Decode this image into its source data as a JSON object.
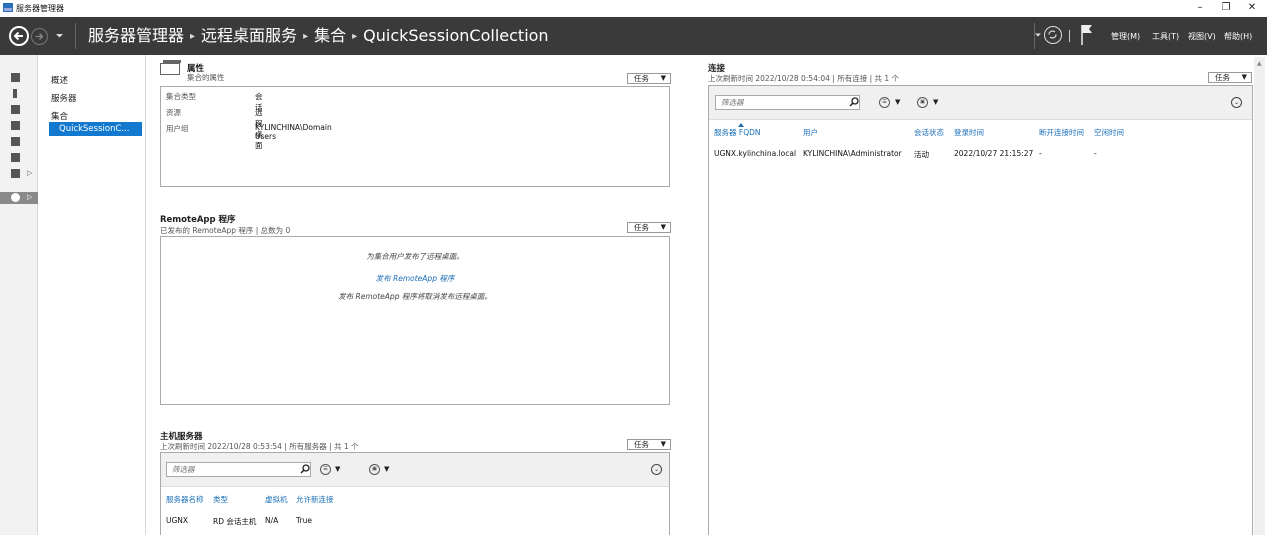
{
  "window": {
    "title": "服务器管理器",
    "minimize": "–",
    "restore": "❐",
    "close": "✕"
  },
  "header": {
    "breadcrumb": [
      "服务器管理器",
      "远程桌面服务",
      "集合",
      "QuickSessionCollection"
    ],
    "separator": "▸",
    "menus": [
      "管理(M)",
      "工具(T)",
      "视图(V)",
      "帮助(H)"
    ]
  },
  "nav": {
    "items": [
      "概述",
      "服务器",
      "集合"
    ],
    "sub_item": "QuickSessionC..."
  },
  "properties": {
    "title": "属性",
    "subtitle": "集合的属性",
    "tasks_label": "任务",
    "rows": [
      {
        "key": "集合类型",
        "value": "会话"
      },
      {
        "key": "资源",
        "value": "远程桌面"
      },
      {
        "key": "用户组",
        "value": "KYLINCHINA\\Domain Users"
      }
    ]
  },
  "remoteapp": {
    "title": "RemoteApp 程序",
    "subtitle": "已发布的 RemoteApp 程序 | 总数为 0",
    "tasks_label": "任务",
    "line1": "为集合用户发布了远程桌面。",
    "link": "发布 RemoteApp 程序",
    "line3": "发布 RemoteApp 程序将取消发布远程桌面。"
  },
  "hosts": {
    "title": "主机服务器",
    "subtitle": "上次刷新时间 2022/10/28 0:53:54 | 所有服务器 | 共 1 个",
    "tasks_label": "任务",
    "filter_placeholder": "筛选器",
    "columns": [
      "服务器名称",
      "类型",
      "虚拟机",
      "允许新连接"
    ],
    "rows": [
      [
        "UGNX",
        "RD 会话主机",
        "N/A",
        "True"
      ]
    ]
  },
  "connections": {
    "title": "连接",
    "subtitle": "上次刷新时间 2022/10/28 0:54:04 | 所有连接 | 共 1 个",
    "tasks_label": "任务",
    "filter_placeholder": "筛选器",
    "columns": [
      "服务器 FQDN",
      "用户",
      "会话状态",
      "登录时间",
      "断开连接时间",
      "空闲时间"
    ],
    "rows": [
      [
        "UGNX.kylinchina.local",
        "KYLINCHINA\\Administrator",
        "活动",
        "2022/10/27 21:15:27",
        "-",
        "-"
      ]
    ]
  }
}
